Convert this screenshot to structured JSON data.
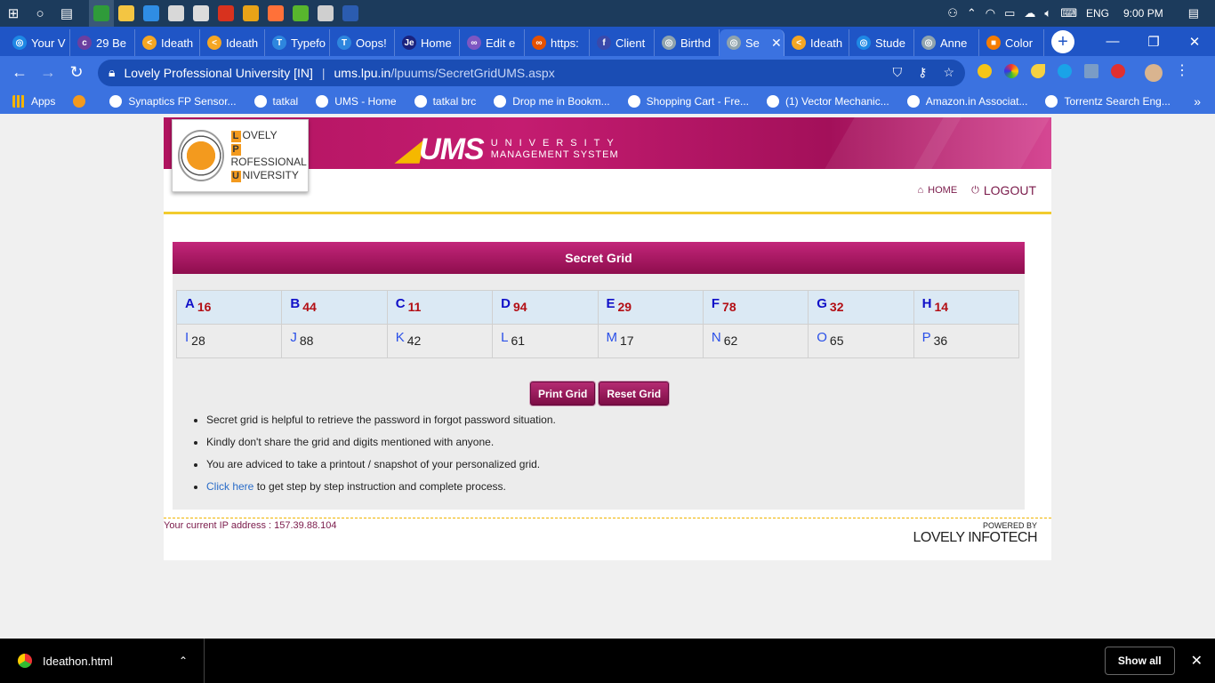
{
  "taskbar": {
    "apps": [
      {
        "name": "chrome",
        "color": "#2f9b3a",
        "active": true
      },
      {
        "name": "file-explorer",
        "color": "#f4c542"
      },
      {
        "name": "edge",
        "color": "#2f8de4"
      },
      {
        "name": "store",
        "color": "#d8d8d8"
      },
      {
        "name": "mail",
        "color": "#dcdcdc"
      },
      {
        "name": "app-p",
        "color": "#d8321e"
      },
      {
        "name": "app-s",
        "color": "#e8a317"
      },
      {
        "name": "firefox",
        "color": "#ff7139"
      },
      {
        "name": "utorrent",
        "color": "#58b62d"
      },
      {
        "name": "photos",
        "color": "#cfcfcf"
      },
      {
        "name": "word",
        "color": "#2b5cb0"
      }
    ],
    "language": "ENG",
    "time": "9:00 PM"
  },
  "tabs": [
    {
      "label": "Your V",
      "color": "#1e88e5",
      "glyph": "◎"
    },
    {
      "label": "29 Be",
      "color": "#6b3fa0",
      "glyph": "c"
    },
    {
      "label": "Ideath",
      "color": "#f5a623",
      "glyph": "<"
    },
    {
      "label": "Ideath",
      "color": "#f5a623",
      "glyph": "<"
    },
    {
      "label": "Typefo",
      "color": "#2e86de",
      "glyph": "T"
    },
    {
      "label": "Oops!",
      "color": "#2e86de",
      "glyph": "T"
    },
    {
      "label": "Home",
      "color": "#1a237e",
      "glyph": "Je"
    },
    {
      "label": "Edit e",
      "color": "#7e57c2",
      "glyph": "∞"
    },
    {
      "label": "https:",
      "color": "#e65100",
      "glyph": "∞"
    },
    {
      "label": "Client",
      "color": "#3949ab",
      "glyph": "f"
    },
    {
      "label": "Birthd",
      "color": "#90a4ae",
      "glyph": "◎"
    },
    {
      "label": "Se",
      "color": "#90a4ae",
      "glyph": "◎",
      "active": true
    },
    {
      "label": "Ideath",
      "color": "#f5a623",
      "glyph": "<"
    },
    {
      "label": "Stude",
      "color": "#1e88e5",
      "glyph": "◎"
    },
    {
      "label": "Anne",
      "color": "#90a4ae",
      "glyph": "◎"
    },
    {
      "label": "Color",
      "color": "#f57c00",
      "glyph": "■"
    }
  ],
  "address": {
    "site": "Lovely Professional University [IN]",
    "host": "ums.lpu.in",
    "path": "/lpuums/SecretGridUMS.aspx"
  },
  "bookmarks": [
    {
      "label": "Apps"
    },
    {
      "label": ""
    },
    {
      "label": "Synaptics FP Sensor..."
    },
    {
      "label": "tatkal"
    },
    {
      "label": "UMS - Home"
    },
    {
      "label": "tatkal brc"
    },
    {
      "label": "Drop me in Bookm..."
    },
    {
      "label": "Shopping Cart - Fre..."
    },
    {
      "label": "(1) Vector Mechanic..."
    },
    {
      "label": "Amazon.in Associat..."
    },
    {
      "label": "Torrentz Search Eng..."
    }
  ],
  "header": {
    "logo_lines": [
      {
        "initial": "L",
        "rest": "OVELY"
      },
      {
        "initial": "P",
        "rest": "ROFESSIONAL"
      },
      {
        "initial": "U",
        "rest": "NIVERSITY"
      }
    ],
    "ums_text": "UMS",
    "ums_sub1": "UNIVERSITY",
    "ums_sub2": "MANAGEMENT SYSTEM",
    "home_label": "HOME",
    "logout_label": "LOGOUT"
  },
  "secret_grid": {
    "title": "Secret Grid",
    "rows": [
      [
        {
          "k": "A",
          "v": "16"
        },
        {
          "k": "B",
          "v": "44"
        },
        {
          "k": "C",
          "v": "11"
        },
        {
          "k": "D",
          "v": "94"
        },
        {
          "k": "E",
          "v": "29"
        },
        {
          "k": "F",
          "v": "78"
        },
        {
          "k": "G",
          "v": "32"
        },
        {
          "k": "H",
          "v": "14"
        }
      ],
      [
        {
          "k": "I",
          "v": "28"
        },
        {
          "k": "J",
          "v": "88"
        },
        {
          "k": "K",
          "v": "42"
        },
        {
          "k": "L",
          "v": "61"
        },
        {
          "k": "M",
          "v": "17"
        },
        {
          "k": "N",
          "v": "62"
        },
        {
          "k": "O",
          "v": "65"
        },
        {
          "k": "P",
          "v": "36"
        }
      ]
    ],
    "print_label": "Print Grid",
    "reset_label": "Reset Grid"
  },
  "notes": {
    "n1": "Secret grid is helpful to retrieve the password in forgot password situation.",
    "n2": "Kindly don't share the grid and digits mentioned with anyone.",
    "n3": "You are adviced to take a printout / snapshot of your personalized grid.",
    "n4_link": "Click here",
    "n4_rest": " to get step by step instruction and complete process."
  },
  "footer": {
    "ip": "Your current IP address : 157.39.88.104",
    "powered_by": "POWERED BY",
    "company": "LOVELY INFOTECH"
  },
  "downloads": {
    "file": "Ideathon.html",
    "show_all": "Show all"
  }
}
